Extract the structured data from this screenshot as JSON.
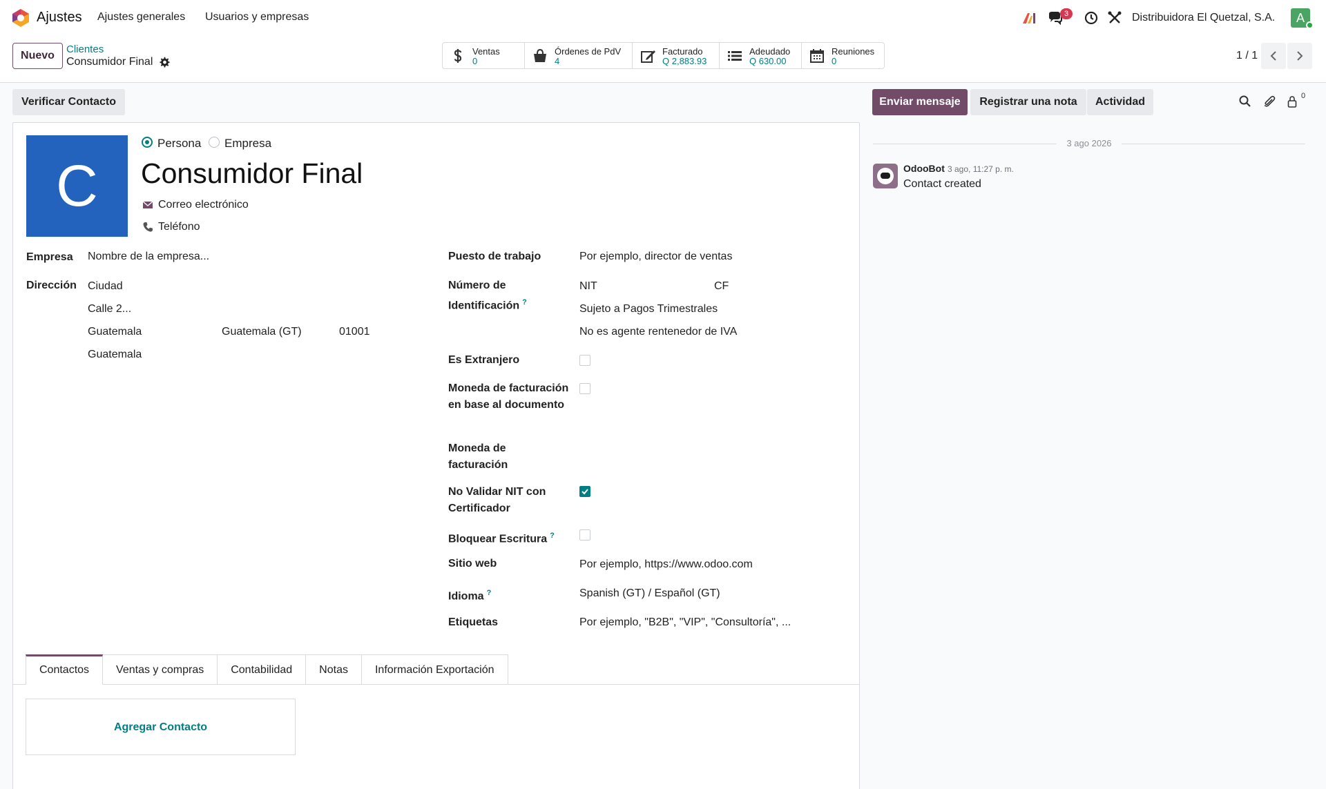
{
  "navbar": {
    "app_name": "Ajustes",
    "menu": [
      "Ajustes generales",
      "Usuarios y empresas"
    ],
    "messages_badge": "3",
    "company": "Distribuidora El Quetzal, S.A.",
    "avatar_letter": "A",
    "icons": [
      "app-logo-icon",
      "ai-icon",
      "chat-icon",
      "clock-icon",
      "tools-icon"
    ]
  },
  "control": {
    "new_button": "Nuevo",
    "breadcrumb_parent": "Clientes",
    "breadcrumb_current": "Consumidor Final",
    "pager": "1 / 1",
    "stats": [
      {
        "label": "Ventas",
        "value": "0",
        "icon": "dollar-icon"
      },
      {
        "label": "Órdenes de PdV",
        "value": "4",
        "icon": "shopping-bag-icon"
      },
      {
        "label": "Facturado",
        "value": "Q 2,883.93",
        "icon": "edit-icon"
      },
      {
        "label": "Adeudado",
        "value": "Q 630.00",
        "icon": "list-icon"
      },
      {
        "label": "Reuniones",
        "value": "0",
        "icon": "calendar-icon"
      }
    ]
  },
  "actions": {
    "verify": "Verificar Contacto"
  },
  "form": {
    "photo_letter": "C",
    "type_person": "Persona",
    "type_company": "Empresa",
    "name": "Consumidor Final",
    "email_placeholder": "Correo electrónico",
    "phone_placeholder": "Teléfono",
    "left": {
      "company_label": "Empresa",
      "company_placeholder": "Nombre de la empresa...",
      "address_label": "Dirección",
      "street": "Ciudad",
      "street2_placeholder": "Calle 2...",
      "city": "Guatemala",
      "state": "Guatemala (GT)",
      "zip": "01001",
      "country": "Guatemala"
    },
    "right": {
      "job_label": "Puesto de trabajo",
      "job_placeholder": "Por ejemplo, director de ventas",
      "id_label": "Número de Identificación",
      "id_type": "NIT",
      "id_value": "CF",
      "tax_regime": "Sujeto a Pagos Trimestrales",
      "iva_agent": "No es agente rentenedor de IVA",
      "foreign_label": "Es Extranjero",
      "doc_currency_label": "Moneda de facturación en base al documento",
      "currency_label": "Moneda de facturación",
      "no_validate_label": "No Validar NIT con Certificador",
      "lock_label": "Bloquear Escritura",
      "website_label": "Sitio web",
      "website_placeholder": "Por ejemplo, https://www.odoo.com",
      "lang_label": "Idioma",
      "lang_value": "Spanish (GT) / Español (GT)",
      "tags_label": "Etiquetas",
      "tags_placeholder": "Por ejemplo, \"B2B\", \"VIP\", \"Consultoría\", ...",
      "help_mark": "?"
    },
    "checkboxes": {
      "foreign": false,
      "doc_currency": false,
      "no_validate": true,
      "lock": false
    },
    "tabs": [
      "Contactos",
      "Ventas y compras",
      "Contabilidad",
      "Notas",
      "Información Exportación"
    ],
    "add_contact": "Agregar Contacto"
  },
  "chatter": {
    "send_message": "Enviar mensaje",
    "log_note": "Registrar una nota",
    "activity": "Actividad",
    "followers_count": "0",
    "date_separator": "3 ago 2026",
    "messages": [
      {
        "author": "OdooBot",
        "time": "3 ago, 11:27 p. m.",
        "body": "Contact created"
      }
    ]
  },
  "colors": {
    "primary": "#714b67",
    "link": "#017e84",
    "avatar_bg": "#2463bd"
  }
}
